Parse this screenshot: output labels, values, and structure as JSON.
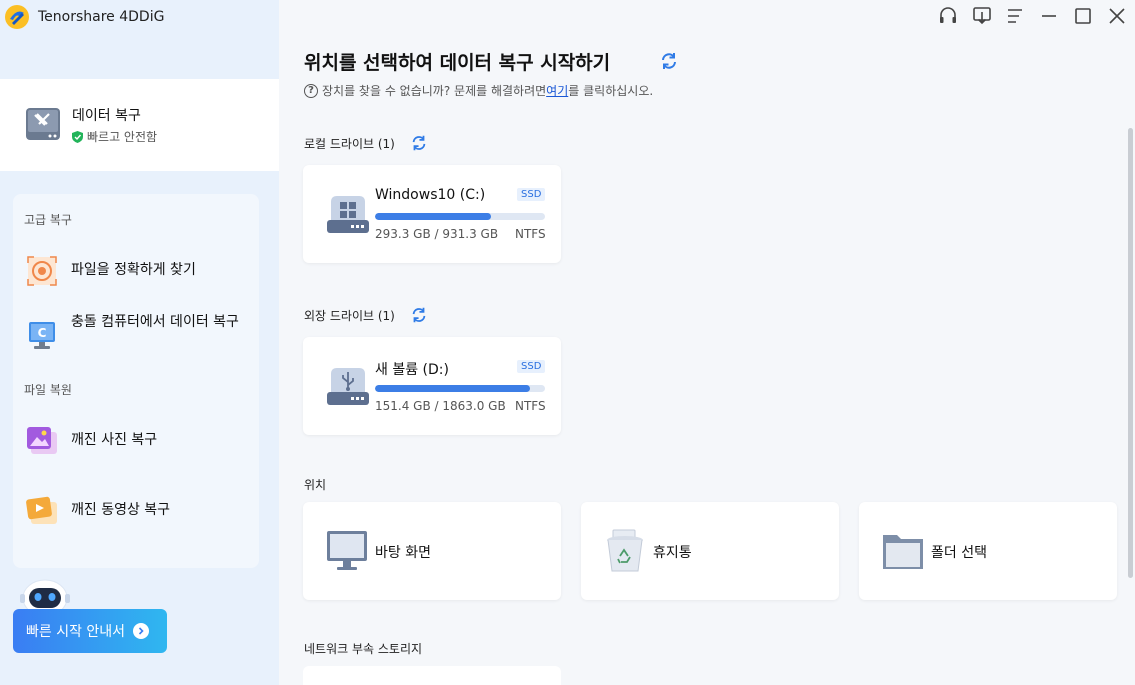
{
  "app": {
    "name": "Tenorshare 4DDiG"
  },
  "sidebar": {
    "recover": {
      "title": "데이터 복구",
      "subtitle": "빠르고 안전함"
    },
    "advanced_label": "고급 복구",
    "advanced_items": [
      {
        "label": "파일을 정확하게 찾기",
        "icon": "target-file-icon"
      },
      {
        "label": "충돌 컴퓨터에서 데이터 복구",
        "icon": "crashed-computer-icon"
      }
    ],
    "repair_label": "파일 복원",
    "repair_items": [
      {
        "label": "깨진 사진 복구",
        "icon": "photo-repair-icon"
      },
      {
        "label": "깨진 동영상 복구",
        "icon": "video-repair-icon"
      }
    ],
    "guide_button": "빠른 시작 안내서"
  },
  "main": {
    "title": "위치를 선택하여 데이터 복구 시작하기",
    "help_prefix": "장치를 찾을 수 없습니까? 문제를 해결하려면 ",
    "help_link": "여기",
    "help_suffix": "를 클릭하십시오.",
    "local_label": "로컬 드라이브 (1)",
    "external_label": "외장 드라이브 (1)",
    "location_label": "위치",
    "network_label": "네트워크 부속 스토리지",
    "local_drives": [
      {
        "name": "Windows10 (C:)",
        "badge": "SSD",
        "size": "293.3 GB / 931.3 GB",
        "fs": "NTFS",
        "used_fraction": 0.68
      }
    ],
    "external_drives": [
      {
        "name": "새 볼륨 (D:)",
        "badge": "SSD",
        "size": "151.4 GB / 1863.0 GB",
        "fs": "NTFS",
        "used_fraction": 0.91
      }
    ],
    "locations": [
      {
        "label": "바탕 화면",
        "icon": "desktop-icon"
      },
      {
        "label": "휴지통",
        "icon": "recycle-bin-icon"
      },
      {
        "label": "폴더 선택",
        "icon": "folder-icon"
      }
    ]
  },
  "colors": {
    "accent": "#3c7ee6",
    "sidebar_bg": "#e8f1fc",
    "link": "#1a58d6"
  }
}
